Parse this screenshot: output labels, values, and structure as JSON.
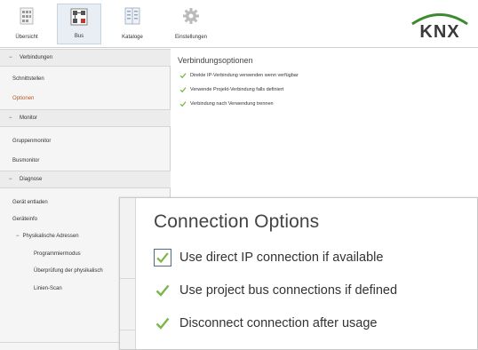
{
  "toolbar": {
    "buttons": [
      {
        "label": "Übersicht",
        "icon": "overview-grid-icon"
      },
      {
        "label": "Bus",
        "icon": "bus-network-icon"
      },
      {
        "label": "Kataloge",
        "icon": "catalog-icon"
      },
      {
        "label": "Einstellungen",
        "icon": "gear-icon"
      }
    ],
    "active": "Bus",
    "logo": "KNX",
    "logo_color": "#3d8a2f"
  },
  "sidebar": {
    "sections": [
      {
        "title": "Verbindungen",
        "items": [
          {
            "label": "Schnittstellen"
          },
          {
            "label": "Optionen",
            "selected": true
          }
        ]
      },
      {
        "title": "Monitor",
        "items": [
          {
            "label": "Gruppenmonitor"
          },
          {
            "label": "Busmonitor"
          }
        ]
      },
      {
        "title": "Diagnose",
        "items": [
          {
            "label": "Gerät entladen"
          },
          {
            "label": "Geräteinfo"
          },
          {
            "label": "Physikalische Adressen"
          },
          {
            "label": "Programmiermodus"
          },
          {
            "label": "Überprüfung der physikalisch"
          },
          {
            "label": "Linien-Scan"
          }
        ]
      }
    ],
    "collapse_symbol": "−",
    "selected_color": "#b5582a"
  },
  "main": {
    "title": "Verbindungsoptionen",
    "options": [
      {
        "label": "Direkte IP-Verbindung verwenden wenn verfügbar",
        "checked": true
      },
      {
        "label": "Verwende Projekt-Verbindung falls definiert",
        "checked": true
      },
      {
        "label": "Verbindung nach Verwendung trennen",
        "checked": true
      }
    ],
    "check_color": "#7ab648"
  },
  "zoom": {
    "title": "Connection Options",
    "options": [
      {
        "label": "Use direct IP connection if available",
        "checked": true,
        "focused": true
      },
      {
        "label": "Use project bus connections if defined",
        "checked": true
      },
      {
        "label": "Disconnect connection after usage",
        "checked": true
      }
    ]
  }
}
